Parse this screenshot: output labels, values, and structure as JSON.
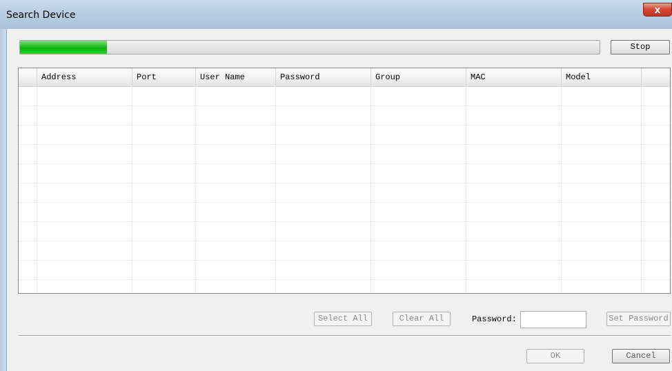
{
  "window": {
    "title": "Search Device",
    "close_label": "x"
  },
  "progress": {
    "fraction": 0.15,
    "fill_color": "#1dbd1d"
  },
  "toolbar": {
    "stop_label": "Stop"
  },
  "table": {
    "columns": [
      "",
      "Address",
      "Port",
      "User Name",
      "Password",
      "Group",
      "MAC",
      "Model",
      ""
    ],
    "rows": []
  },
  "actions": {
    "select_all_label": "Select All",
    "clear_all_label": "Clear All",
    "password_label": "Password:",
    "password_value": "",
    "set_password_label": "Set Password"
  },
  "footer": {
    "ok_label": "OK",
    "cancel_label": "Cancel"
  }
}
